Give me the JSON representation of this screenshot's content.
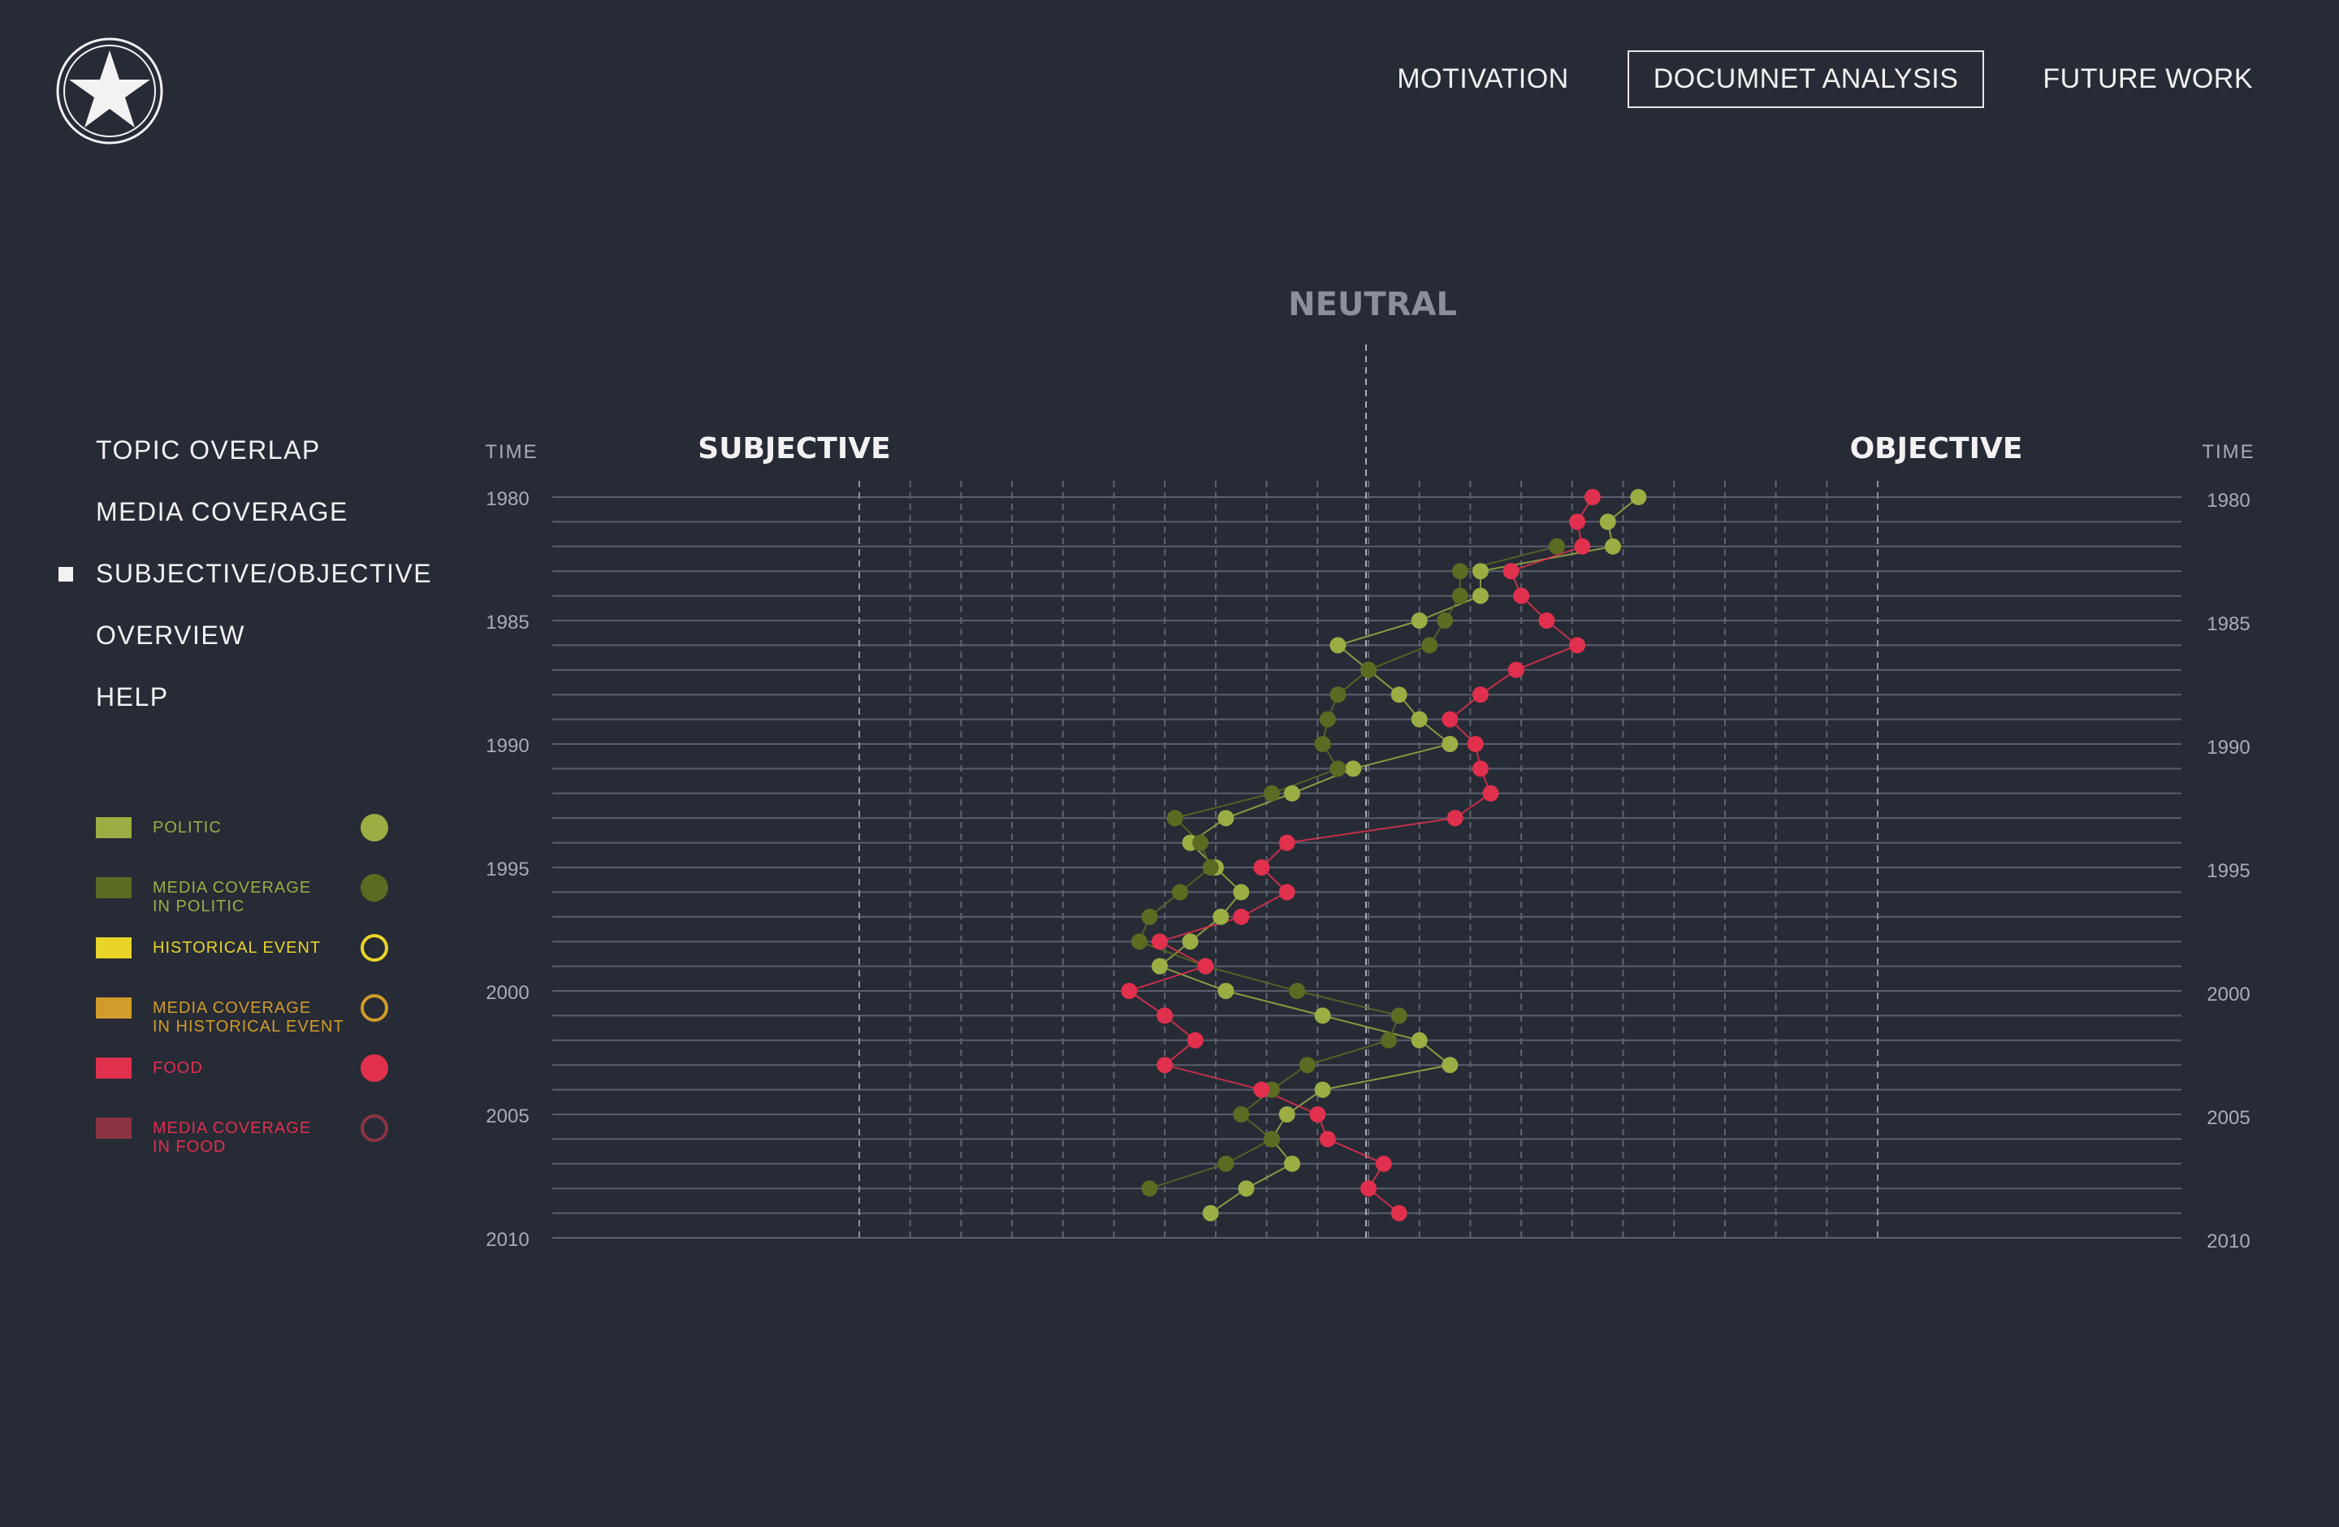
{
  "nav": {
    "items": [
      {
        "label": "MOTIVATION",
        "active": false
      },
      {
        "label": "DOCUMNET ANALYSIS",
        "active": true
      },
      {
        "label": "FUTURE WORK",
        "active": false
      }
    ]
  },
  "logo_icon": "star-badge-icon",
  "sidebar": {
    "items": [
      {
        "label": "TOPIC OVERLAP",
        "active": false
      },
      {
        "label": "MEDIA COVERAGE",
        "active": false
      },
      {
        "label": "SUBJECTIVE/OBJECTIVE",
        "active": true
      },
      {
        "label": "OVERVIEW",
        "active": false
      },
      {
        "label": "HELP",
        "active": false
      }
    ]
  },
  "legend": [
    {
      "label_lines": [
        "POLITIC"
      ],
      "color": "#9aae44",
      "marker": "filled"
    },
    {
      "label_lines": [
        "MEDIA COVERAGE",
        "IN POLITIC"
      ],
      "color": "#5c6b22",
      "marker": "filled",
      "text_color": "#9aae44"
    },
    {
      "label_lines": [
        "HISTORICAL EVENT"
      ],
      "color": "#e9d42a",
      "marker": "ring"
    },
    {
      "label_lines": [
        "MEDIA COVERAGE",
        "IN HISTORICAL EVENT"
      ],
      "color": "#d29c2a",
      "marker": "ring"
    },
    {
      "label_lines": [
        "FOOD"
      ],
      "color": "#e0304d",
      "marker": "filled"
    },
    {
      "label_lines": [
        "MEDIA COVERAGE",
        "IN FOOD"
      ],
      "color": "#8c3444",
      "marker": "ring",
      "text_color": "#e0304d"
    }
  ],
  "chart_data": {
    "type": "line",
    "labels": {
      "neutral": "NEUTRAL",
      "subjective": "SUBJECTIVE",
      "objective": "OBJECTIVE",
      "time_left": "TIME",
      "time_right": "TIME"
    },
    "x_range": [
      -1,
      1
    ],
    "y_range": [
      1980,
      2010
    ],
    "year_ticks": [
      "1980",
      "1985",
      "1990",
      "1995",
      "2000",
      "2005",
      "2010"
    ],
    "series": [
      {
        "name": "POLITIC",
        "color": "#9aae44",
        "points": [
          [
            0.53,
            1980
          ],
          [
            0.47,
            1981
          ],
          [
            0.48,
            1982
          ],
          [
            0.22,
            1983
          ],
          [
            0.22,
            1984
          ],
          [
            0.1,
            1985
          ],
          [
            -0.06,
            1986
          ],
          [
            0.0,
            1987
          ],
          [
            0.06,
            1988
          ],
          [
            0.1,
            1989
          ],
          [
            0.16,
            1990
          ],
          [
            -0.03,
            1991
          ],
          [
            -0.15,
            1992
          ],
          [
            -0.28,
            1993
          ],
          [
            -0.35,
            1994
          ],
          [
            -0.3,
            1995
          ],
          [
            -0.25,
            1996
          ],
          [
            -0.29,
            1997
          ],
          [
            -0.35,
            1998
          ],
          [
            -0.41,
            1999
          ],
          [
            -0.28,
            2000
          ],
          [
            -0.09,
            2001
          ],
          [
            0.1,
            2002
          ],
          [
            0.16,
            2003
          ],
          [
            -0.09,
            2004
          ],
          [
            -0.16,
            2005
          ],
          [
            -0.19,
            2006
          ],
          [
            -0.15,
            2007
          ],
          [
            -0.24,
            2008
          ],
          [
            -0.31,
            2009
          ]
        ]
      },
      {
        "name": "MEDIA COVERAGE IN POLITIC",
        "color": "#5c6b22",
        "points": [
          [
            0.37,
            1982
          ],
          [
            0.18,
            1983
          ],
          [
            0.18,
            1984
          ],
          [
            0.15,
            1985
          ],
          [
            0.12,
            1986
          ],
          [
            0.0,
            1987
          ],
          [
            -0.06,
            1988
          ],
          [
            -0.08,
            1989
          ],
          [
            -0.09,
            1990
          ],
          [
            -0.06,
            1991
          ],
          [
            -0.19,
            1992
          ],
          [
            -0.38,
            1993
          ],
          [
            -0.33,
            1994
          ],
          [
            -0.31,
            1995
          ],
          [
            -0.37,
            1996
          ],
          [
            -0.43,
            1997
          ],
          [
            -0.45,
            1998
          ],
          [
            -0.32,
            1999
          ],
          [
            -0.14,
            2000
          ],
          [
            0.06,
            2001
          ],
          [
            0.04,
            2002
          ],
          [
            -0.12,
            2003
          ],
          [
            -0.19,
            2004
          ],
          [
            -0.25,
            2005
          ],
          [
            -0.19,
            2006
          ],
          [
            -0.28,
            2007
          ],
          [
            -0.43,
            2008
          ]
        ]
      },
      {
        "name": "FOOD",
        "color": "#e0304d",
        "points": [
          [
            0.44,
            1980
          ],
          [
            0.41,
            1981
          ],
          [
            0.42,
            1982
          ],
          [
            0.28,
            1983
          ],
          [
            0.3,
            1984
          ],
          [
            0.35,
            1985
          ],
          [
            0.41,
            1986
          ],
          [
            0.29,
            1987
          ],
          [
            0.22,
            1988
          ],
          [
            0.16,
            1989
          ],
          [
            0.21,
            1990
          ],
          [
            0.22,
            1991
          ],
          [
            0.24,
            1992
          ],
          [
            0.17,
            1993
          ],
          [
            -0.16,
            1994
          ],
          [
            -0.21,
            1995
          ],
          [
            -0.16,
            1996
          ],
          [
            -0.25,
            1997
          ],
          [
            -0.41,
            1998
          ],
          [
            -0.32,
            1999
          ],
          [
            -0.47,
            2000
          ],
          [
            -0.4,
            2001
          ],
          [
            -0.34,
            2002
          ],
          [
            -0.4,
            2003
          ],
          [
            -0.21,
            2004
          ],
          [
            -0.1,
            2005
          ],
          [
            -0.08,
            2006
          ],
          [
            0.03,
            2007
          ],
          [
            0.0,
            2008
          ],
          [
            0.06,
            2009
          ]
        ]
      }
    ]
  }
}
